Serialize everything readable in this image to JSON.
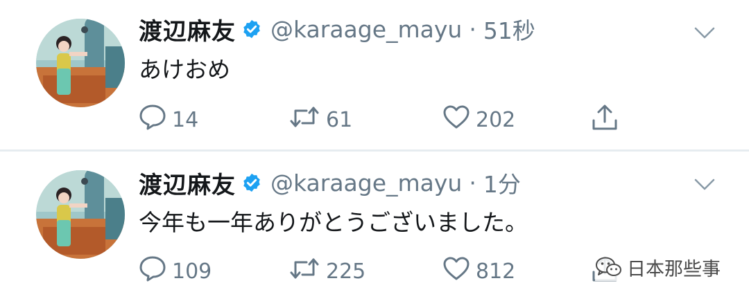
{
  "colors": {
    "name": "#14171a",
    "secondary": "#657786",
    "verified": "#1da1f2",
    "divider": "#e6ecf0"
  },
  "tweets": [
    {
      "author_name": "渡辺麻友",
      "handle": "@karaage_mayu",
      "separator": "·",
      "time": "51秒",
      "text": "あけおめ",
      "reply_count": "14",
      "retweet_count": "61",
      "like_count": "202",
      "icons": [
        "avatar",
        "verified-badge-icon",
        "chevron-down-icon",
        "reply-icon",
        "retweet-icon",
        "like-icon",
        "share-icon"
      ]
    },
    {
      "author_name": "渡辺麻友",
      "handle": "@karaage_mayu",
      "separator": "·",
      "time": "1分",
      "text": "今年も一年ありがとうございました。",
      "reply_count": "109",
      "retweet_count": "225",
      "like_count": "812",
      "icons": [
        "avatar",
        "verified-badge-icon",
        "chevron-down-icon",
        "reply-icon",
        "retweet-icon",
        "like-icon",
        "share-icon"
      ]
    }
  ],
  "watermark": {
    "text": "日本那些事",
    "icon": "wechat-icon"
  }
}
